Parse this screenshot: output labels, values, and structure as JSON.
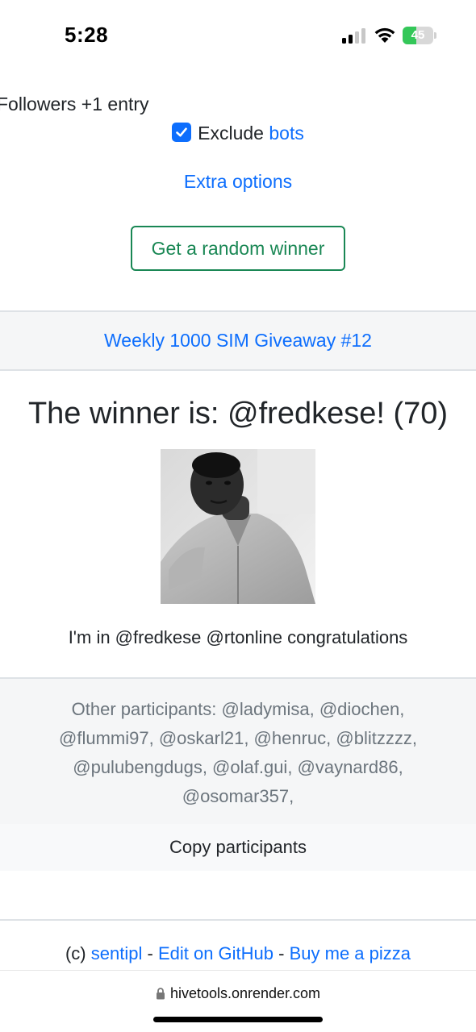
{
  "status_bar": {
    "time": "5:28",
    "battery_level": "45",
    "battery_fraction": 0.45,
    "signal_bars_active": 2,
    "signal_bars_total": 4
  },
  "settings": {
    "followers_text": "Followers +1 entry",
    "exclude_label": "Exclude",
    "exclude_link": "bots",
    "exclude_checked": true,
    "extra_options": "Extra options",
    "winner_button": "Get a random winner"
  },
  "giveaway": {
    "title": "Weekly 1000 SIM Giveaway #12"
  },
  "result": {
    "heading": "The winner is: @fredkese! (70)",
    "comment": "I'm in @fredkese @rtonline congratulations"
  },
  "participants": {
    "text": "Other participants: @ladymisa, @diochen, @flummi97, @oskarl21, @henruc, @blitzzzz, @pulubengdugs, @olaf.gui, @vaynard86, @osomar357,",
    "copy_label": "Copy participants"
  },
  "footer": {
    "prefix": "(c)",
    "author": "sentipl",
    "sep1": "-",
    "github": "Edit on GitHub",
    "sep2": "-",
    "pizza": "Buy me a pizza"
  },
  "browser": {
    "url": "hivetools.onrender.com"
  },
  "colors": {
    "link": "#0d6efd",
    "success": "#198754",
    "muted": "#6c757d",
    "battery": "#34c759"
  },
  "icons": [
    "signal-icon",
    "wifi-icon",
    "battery-icon",
    "checkbox-icon",
    "lock-icon"
  ]
}
